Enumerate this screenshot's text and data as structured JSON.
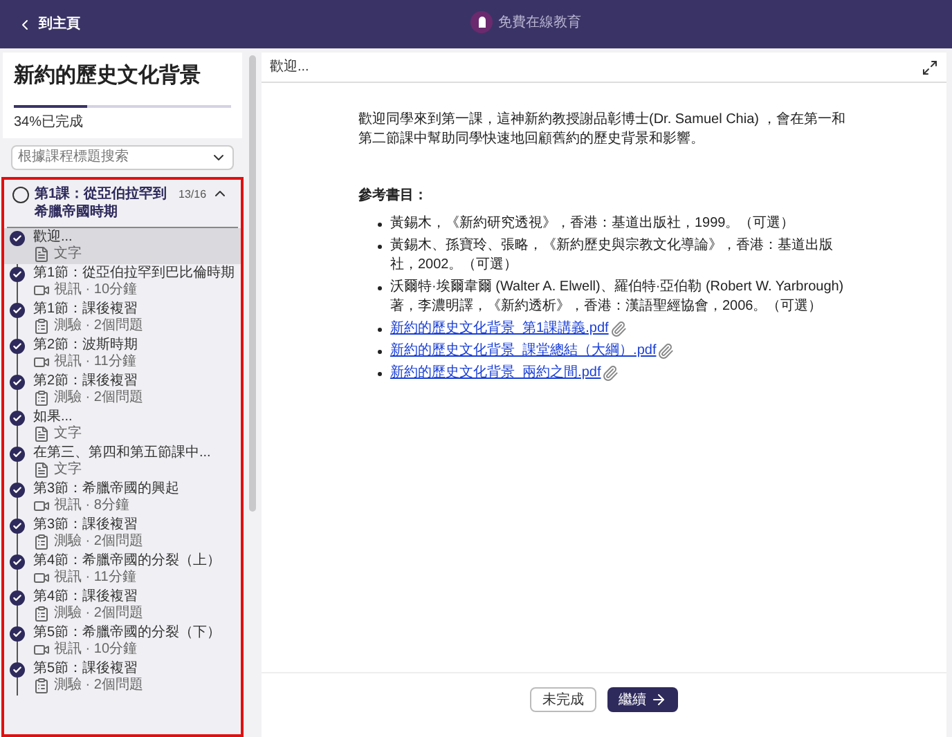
{
  "header": {
    "back": "到主頁",
    "brand": "免費在線教育"
  },
  "course": {
    "title": "新約的歷史文化背景",
    "progress": {
      "level": 0.34,
      "label": "34%已完成"
    }
  },
  "search": {
    "placeholder": "根據課程標題搜索"
  },
  "lesson": {
    "title": "第1課：從亞伯拉罕到希臘帝國時期",
    "count": "13/16",
    "expanded": true,
    "completed": false,
    "items": [
      {
        "title": "歡迎...",
        "kind": "text",
        "meta": "文字",
        "done": true,
        "selected": true
      },
      {
        "title": "第1節：從亞伯拉罕到巴比倫時期",
        "kind": "video",
        "meta": "視訊 · 10分鐘",
        "done": true,
        "selected": false
      },
      {
        "title": "第1節：課後複習",
        "kind": "quiz",
        "meta": "測驗 · 2個問題",
        "done": true,
        "selected": false
      },
      {
        "title": "第2節：波斯時期",
        "kind": "video",
        "meta": "視訊 · 11分鐘",
        "done": true,
        "selected": false
      },
      {
        "title": "第2節：課後複習",
        "kind": "quiz",
        "meta": "測驗 · 2個問題",
        "done": true,
        "selected": false
      },
      {
        "title": "如果...",
        "kind": "text",
        "meta": "文字",
        "done": true,
        "selected": false
      },
      {
        "title": "在第三、第四和第五節課中...",
        "kind": "text",
        "meta": "文字",
        "done": true,
        "selected": false
      },
      {
        "title": "第3節：希臘帝國的興起",
        "kind": "video",
        "meta": "視訊 · 8分鐘",
        "done": true,
        "selected": false
      },
      {
        "title": "第3節：課後複習",
        "kind": "quiz",
        "meta": "測驗 · 2個問題",
        "done": true,
        "selected": false
      },
      {
        "title": "第4節：希臘帝國的分裂（上）",
        "kind": "video",
        "meta": "視訊 · 11分鐘",
        "done": true,
        "selected": false
      },
      {
        "title": "第4節：課後複習",
        "kind": "quiz",
        "meta": "測驗 · 2個問題",
        "done": true,
        "selected": false
      },
      {
        "title": "第5節：希臘帝國的分裂（下）",
        "kind": "video",
        "meta": "視訊 · 10分鐘",
        "done": true,
        "selected": false
      },
      {
        "title": "第5節：課後複習",
        "kind": "quiz",
        "meta": "測驗 · 2個問題",
        "done": true,
        "selected": false
      }
    ]
  },
  "content": {
    "title": "歡迎...",
    "intro": "歡迎同學來到第一課，這神新約教授謝品彰博士(Dr. Samuel Chia) ，會在第一和第二節課中幫助同學快速地回顧舊約的歷史背景和影響。",
    "references_heading": "參考書目：",
    "references": [
      {
        "kind": "text",
        "text": "黃錫木，《新約研究透視》，香港：基道出版社，1999。（可選）"
      },
      {
        "kind": "text",
        "text": "黃錫木、孫寶玲、張略，《新約歷史與宗教文化導論》，香港：基道出版社，2002。（可選）"
      },
      {
        "kind": "text",
        "text": "沃爾特·埃爾韋爾 (Walter A. Elwell)、羅伯特·亞伯勒 (Robert W. Yarbrough) 著，李濃明譯，《新約透析》，香港：漢語聖經協會，2006。（可選）"
      },
      {
        "kind": "link",
        "text": "新約的歷史文化背景_第1課講義.pdf"
      },
      {
        "kind": "link",
        "text": "新約的歷史文化背景_課堂總結（大綱）.pdf"
      },
      {
        "kind": "link",
        "text": "新約的歷史文化背景_兩約之間.pdf"
      }
    ],
    "buttons": {
      "incomplete": "未完成",
      "next": "繼續"
    }
  }
}
